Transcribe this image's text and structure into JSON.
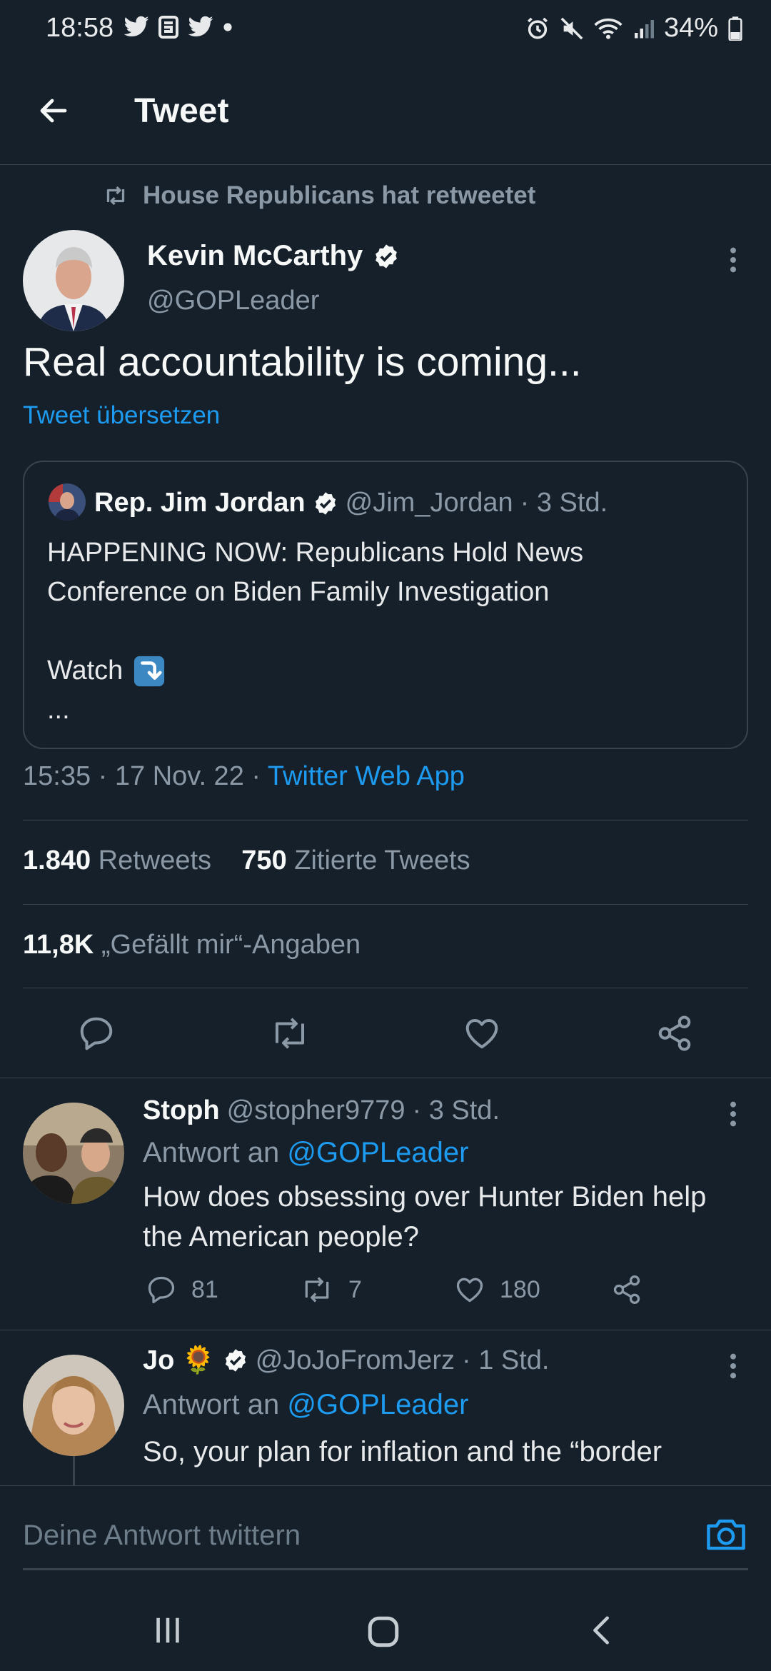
{
  "status_bar": {
    "time": "18:58",
    "battery": "34%"
  },
  "header": {
    "title": "Tweet"
  },
  "retweet_banner": {
    "text": "House Republicans hat retweetet"
  },
  "tweet": {
    "author_name": "Kevin McCarthy",
    "handle": "@GOPLeader",
    "text": "Real accountability is coming...",
    "translate": "Tweet übersetzen",
    "quote": {
      "author_name": "Rep. Jim Jordan",
      "handle": "@Jim_Jordan",
      "time": "· 3 Std.",
      "line1": "HAPPENING NOW: Republicans Hold News",
      "line2": "Conference on Biden Family Investigation",
      "line3": "Watch",
      "line4": "..."
    },
    "timestamp": "15:35 · 17 Nov. 22 · ",
    "source": "Twitter Web App",
    "retweets_count": "1.840",
    "retweets_label": "Retweets",
    "quotes_count": "750",
    "quotes_label": "Zitierte Tweets",
    "likes_count": "11,8K",
    "likes_label": "„Gefällt mir“-Angaben"
  },
  "replies": [
    {
      "name": "Stoph",
      "handle": "@stopher9779",
      "time": "· 3 Std.",
      "reply_to_prefix": "Antwort an",
      "reply_to": "@GOPLeader",
      "text_line1": "How does obsessing over Hunter Biden help",
      "text_line2": "the American people?",
      "comments": "81",
      "retweets": "7",
      "likes": "180"
    },
    {
      "name": "Jo",
      "emoji": "🌻",
      "handle": "@JoJoFromJerz",
      "time": "· 1 Std.",
      "reply_to_prefix": "Antwort an",
      "reply_to": "@GOPLeader",
      "text_line1": "So, your plan for inflation and the “border"
    }
  ],
  "compose": {
    "placeholder": "Deine Antwort twittern"
  },
  "colors": {
    "background": "#15202b",
    "accent": "#1d9bf0",
    "muted": "#8b98a5",
    "divider": "#38444d"
  }
}
